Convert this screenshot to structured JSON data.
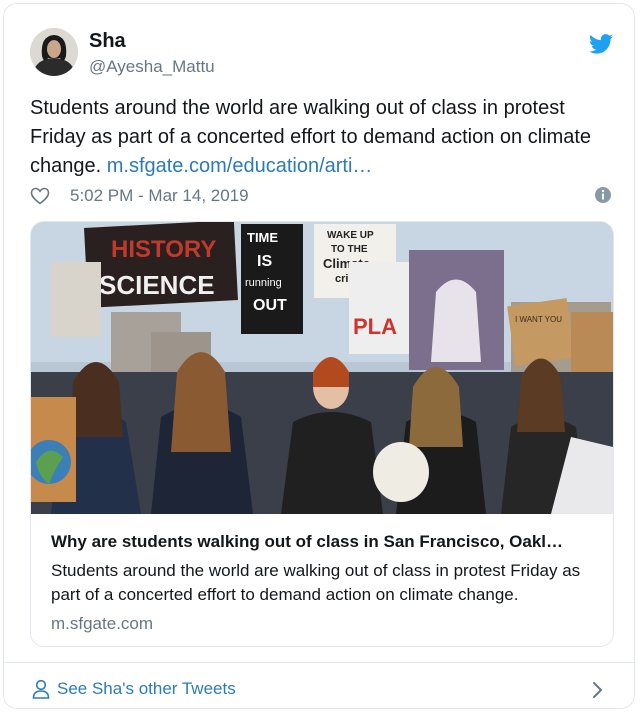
{
  "tweet": {
    "author_name": "Sha",
    "author_handle": "@Ayesha_Mattu",
    "text": "Students around the world are walking out of class in protest Friday as part of a concerted effort to demand action on climate change.",
    "link_text": "m.sfgate.com/education/arti…",
    "timestamp": "5:02 PM - Mar 14, 2019"
  },
  "link_card": {
    "title": "Why are students walking out of class in San Francisco, Oakl…",
    "description": "Students around the world are walking out of class in protest Friday as part of a concerted effort to demand action on climate change.",
    "domain": "m.sfgate.com",
    "image_signs": {
      "sign1": "HISTORY",
      "sign1b": "SCIENCE",
      "sign2a": "TIME",
      "sign2b": "IS",
      "sign2c": "running",
      "sign2d": "OUT",
      "sign3a": "WAKE UP",
      "sign3b": "TO THE",
      "sign3c": "Climate",
      "sign3d": "crisis",
      "sign4": "PLA",
      "sign5": "I WANT YOU"
    }
  },
  "footer": {
    "label": "See Sha's other Tweets"
  },
  "colors": {
    "link": "#2b7bb9",
    "text_secondary": "#657786",
    "border": "#e1e8ed",
    "twitter_blue": "#1da1f2"
  },
  "icons": [
    "twitter-bird-icon",
    "heart-icon",
    "info-icon",
    "person-icon",
    "chevron-right-icon"
  ]
}
